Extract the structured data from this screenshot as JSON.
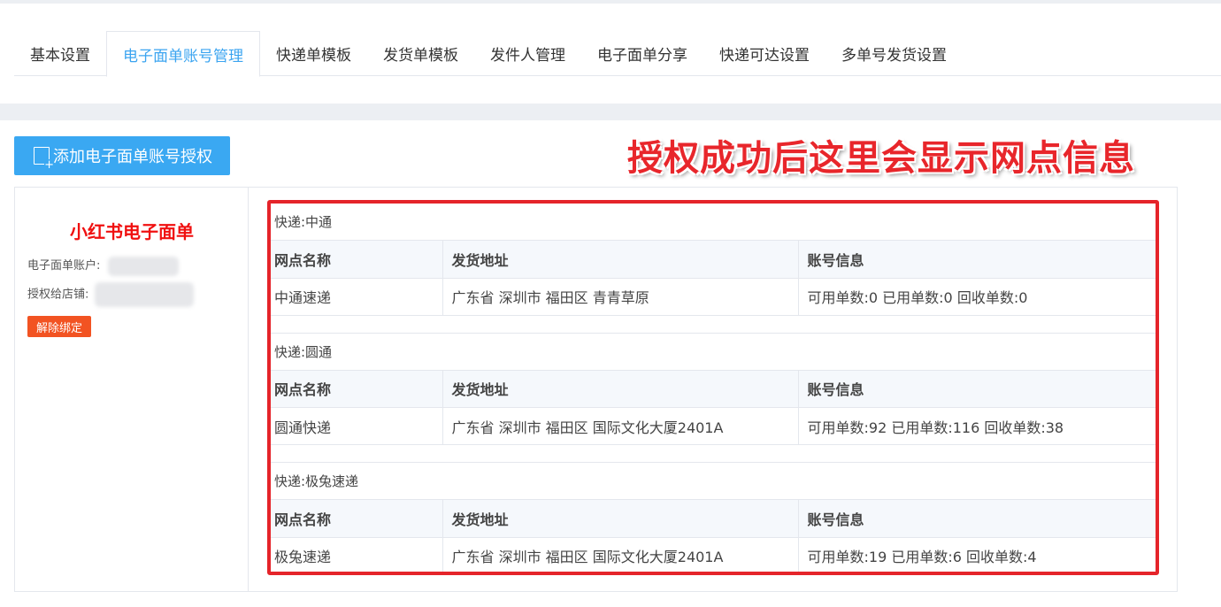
{
  "tabs": [
    {
      "label": "基本设置",
      "active": false
    },
    {
      "label": "电子面单账号管理",
      "active": true
    },
    {
      "label": "快递单模板",
      "active": false
    },
    {
      "label": "发货单模板",
      "active": false
    },
    {
      "label": "发件人管理",
      "active": false
    },
    {
      "label": "电子面单分享",
      "active": false
    },
    {
      "label": "快递可达设置",
      "active": false
    },
    {
      "label": "多单号发货设置",
      "active": false
    }
  ],
  "add_button": {
    "label": "添加电子面单账号授权",
    "icon": "add-document-icon"
  },
  "annotation": "授权成功后这里会显示网点信息",
  "account": {
    "platform": "小红书电子面单",
    "account_label": "电子面单账户:",
    "shop_label": "授权给店铺:",
    "unbind_label": "解除绑定"
  },
  "columns": {
    "branch": "网点名称",
    "address": "发货地址",
    "account_info": "账号信息"
  },
  "carriers": [
    {
      "title": "快递:中通",
      "branch": "中通速递",
      "address": "广东省 深圳市 福田区 青青草原",
      "info": "可用单数:0 已用单数:0 回收单数:0"
    },
    {
      "title": "快递:圆通",
      "branch": "圆通快递",
      "address": "广东省 深圳市 福田区 国际文化大厦2401A",
      "info": "可用单数:92 已用单数:116 回收单数:38"
    },
    {
      "title": "快递:极兔速递",
      "branch": "极兔速递",
      "address": "广东省 深圳市 福田区 国际文化大厦2401A",
      "info": "可用单数:19 已用单数:6 回收单数:4"
    }
  ],
  "colors": {
    "accent": "#3aa8f2",
    "highlight": "#e5242a",
    "danger": "#f25322",
    "brand_red": "#f01010"
  }
}
